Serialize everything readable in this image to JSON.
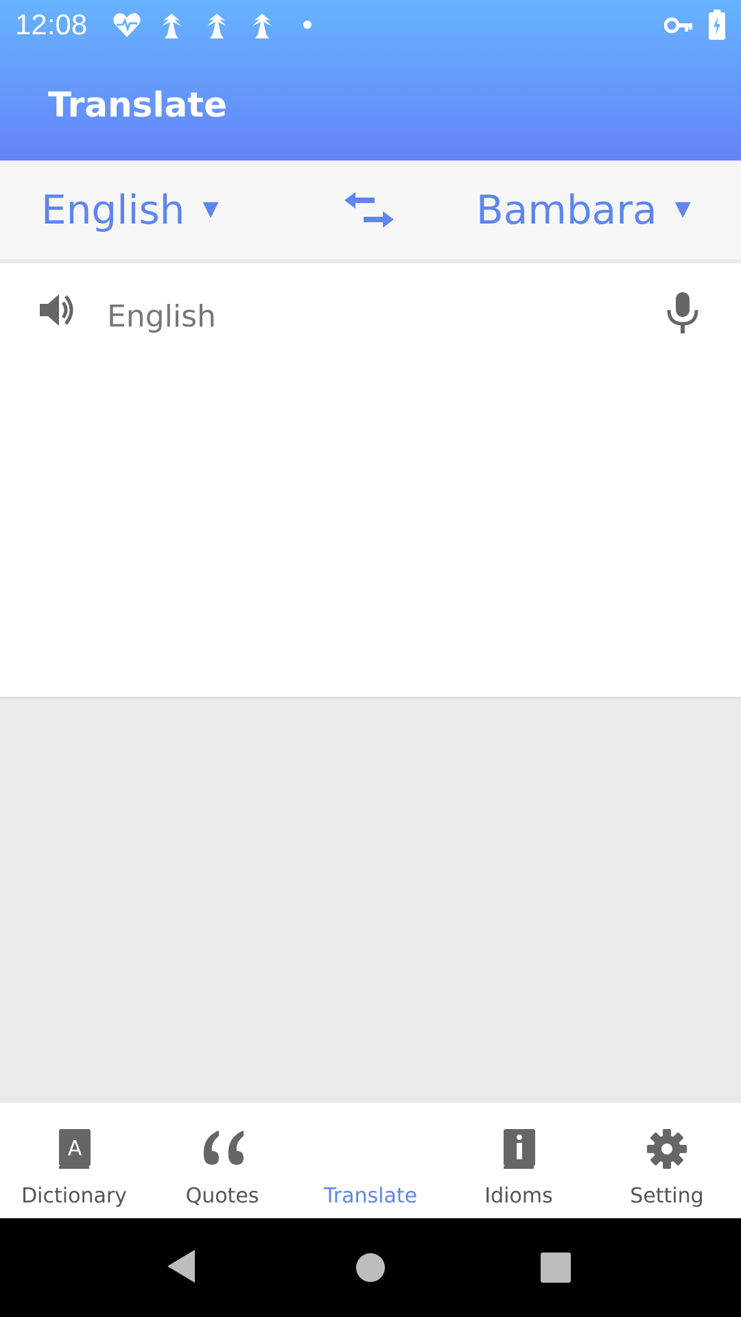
{
  "status_bar": {
    "time": "12:08",
    "left_icons": [
      "heart-pulse-icon",
      "palm-tree-icon",
      "palm-tree-icon",
      "palm-tree-icon",
      "dot-icon"
    ],
    "right_icons": [
      "key-icon",
      "battery-charging-icon"
    ]
  },
  "header": {
    "title": "Translate"
  },
  "languages": {
    "source": "English",
    "target": "Bambara",
    "swap_icon": "swap-arrows-icon"
  },
  "input": {
    "placeholder": "English",
    "value": "",
    "speaker_icon": "speaker-icon",
    "mic_icon": "microphone-icon"
  },
  "bottom_nav": {
    "items": [
      {
        "label": "Dictionary",
        "icon": "dictionary-book-icon"
      },
      {
        "label": "Quotes",
        "icon": "quote-icon"
      },
      {
        "label": "Translate",
        "icon": "translate-icon",
        "active": true
      },
      {
        "label": "Idioms",
        "icon": "info-book-icon"
      },
      {
        "label": "Setting",
        "icon": "gear-icon"
      }
    ]
  },
  "system_nav": {
    "icons": [
      "back-icon",
      "home-icon",
      "recents-icon"
    ]
  },
  "colors": {
    "accent": "#5f86ee",
    "header_top": "#66b3ff",
    "header_bottom": "#6484f7",
    "icon_gray": "#666666",
    "result_background": "#ebebeb"
  }
}
